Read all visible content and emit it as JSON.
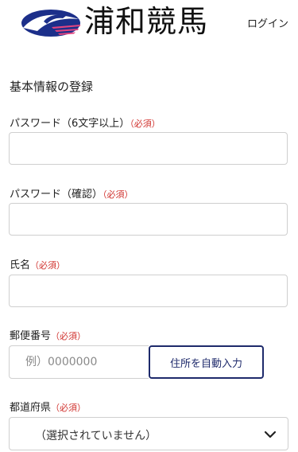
{
  "header": {
    "logo_text": "浦和競馬",
    "login_label": "ログイン"
  },
  "form": {
    "section_title": "基本情報の登録",
    "password": {
      "label": "パスワード（6文字以上）",
      "required": "（必須）",
      "value": ""
    },
    "password_confirm": {
      "label": "パスワード（確認）",
      "required": "（必須）",
      "value": ""
    },
    "name": {
      "label": "氏名",
      "required": "（必須）",
      "value": ""
    },
    "postal": {
      "label": "郵便番号",
      "required": "（必須）",
      "placeholder": "例）0000000",
      "button_label": "住所を自動入力"
    },
    "prefecture": {
      "label": "都道府県",
      "required": "（必須）",
      "selected": "（選択されていません）"
    }
  },
  "colors": {
    "accent": "#1e2a6b",
    "required": "#d0312d",
    "logo_blue": "#1c2f8a",
    "logo_pink": "#e2447f"
  }
}
